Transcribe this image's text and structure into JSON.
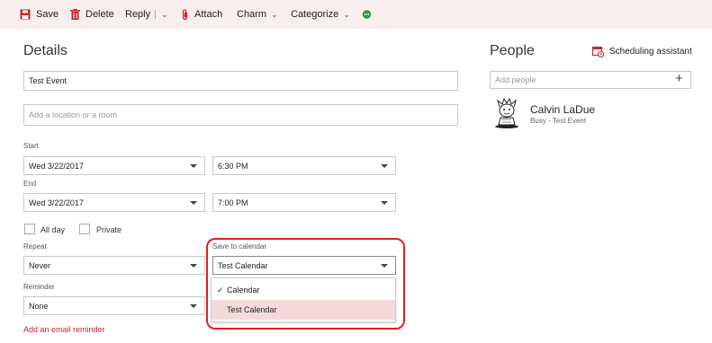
{
  "toolbar": {
    "save_label": "Save",
    "delete_label": "Delete",
    "reply_label": "Reply",
    "attach_label": "Attach",
    "charm_label": "Charm",
    "categorize_label": "Categorize"
  },
  "details": {
    "title": "Details",
    "event_title_value": "Test Event",
    "location_placeholder": "Add a location or a room",
    "start_label": "Start",
    "start_date": "Wed 3/22/2017",
    "start_time": "6:30 PM",
    "end_label": "End",
    "end_date": "Wed 3/22/2017",
    "end_time": "7:00 PM",
    "all_day_label": "All day",
    "private_label": "Private",
    "repeat_label": "Repeat",
    "repeat_value": "Never",
    "save_to_calendar_label": "Save to calendar",
    "save_to_calendar_value": "Test Calendar",
    "reminder_label": "Reminder",
    "reminder_value": "None",
    "email_reminder_link": "Add an email reminder"
  },
  "calendar_dropdown": {
    "options": [
      {
        "label": "Calendar",
        "checked": true
      },
      {
        "label": "Test Calendar",
        "checked": false,
        "highlighted": true
      }
    ],
    "check_glyph": "✓"
  },
  "people": {
    "title": "People",
    "scheduling_label": "Scheduling assistant",
    "add_people_placeholder": "Add people",
    "plus_glyph": "+",
    "attendees": [
      {
        "name": "Calvin LaDue",
        "status": "Busy - Test Event"
      }
    ]
  },
  "colors": {
    "accent": "#c4262e",
    "toolbar_bg": "#f8eeee",
    "highlight_border": "#e02020",
    "selected_option_bg": "#f5d9d9",
    "charm_green": "#2e9a4b"
  }
}
